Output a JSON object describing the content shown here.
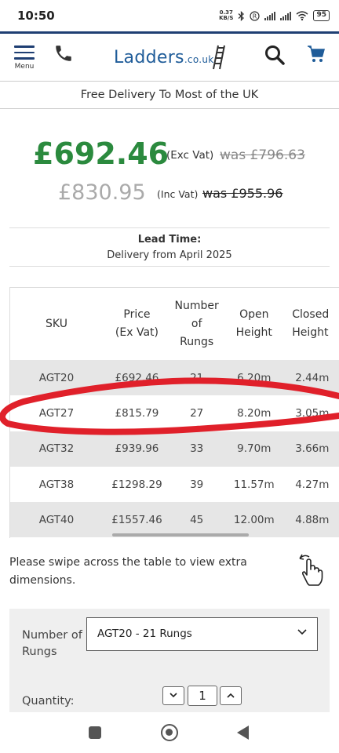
{
  "status_bar": {
    "time": "10:50",
    "net_speed_value": "0.37",
    "net_speed_unit": "KB/S",
    "battery": "95"
  },
  "header": {
    "menu_label": "Menu",
    "logo_main": "Ladders",
    "logo_suffix": ".co.uk"
  },
  "delivery_banner": "Free Delivery To Most of the UK",
  "pricing": {
    "price_ex_vat": "£692.46",
    "ex_vat_label": "(Exc Vat)",
    "was_ex_vat": "was £796.63",
    "price_inc_vat": "£830.95",
    "inc_vat_label": "(Inc Vat)",
    "was_inc_vat": "was £955.96",
    "price_color": "#2b8a3e"
  },
  "lead_time": {
    "title": "Lead Time:",
    "value": "Delivery from April 2025"
  },
  "table": {
    "headers": [
      "SKU",
      "Price (Ex Vat)",
      "Number of Rungs",
      "Open Height",
      "Closed Height"
    ],
    "header_lines": [
      [
        "SKU"
      ],
      [
        "Price",
        "(Ex Vat)"
      ],
      [
        "Number",
        "of",
        "Rungs"
      ],
      [
        "Open",
        "Height"
      ],
      [
        "Closed",
        "Height"
      ]
    ],
    "rows": [
      {
        "sku": "AGT20",
        "price": "£692.46",
        "rungs": "21",
        "open": "6.20m",
        "closed": "2.44m"
      },
      {
        "sku": "AGT27",
        "price": "£815.79",
        "rungs": "27",
        "open": "8.20m",
        "closed": "3.05m"
      },
      {
        "sku": "AGT32",
        "price": "£939.96",
        "rungs": "33",
        "open": "9.70m",
        "closed": "3.66m"
      },
      {
        "sku": "AGT38",
        "price": "£1298.29",
        "rungs": "39",
        "open": "11.57m",
        "closed": "4.27m"
      },
      {
        "sku": "AGT40",
        "price": "£1557.46",
        "rungs": "45",
        "open": "12.00m",
        "closed": "4.88m"
      }
    ],
    "highlighted_sku": "AGT27",
    "highlight_color": "#e0202a"
  },
  "swipe_hint": "Please swipe across the table to view extra dimensions.",
  "options": {
    "variant_label": "Number of Rungs",
    "variant_label_lines": [
      "Number of",
      "Rungs"
    ],
    "variant_selected": "AGT20 - 21 Rungs",
    "quantity_label": "Quantity:",
    "quantity_value": "1"
  },
  "icons": {
    "menu": "hamburger-icon",
    "phone": "phone-icon",
    "search": "search-icon",
    "cart": "cart-icon",
    "swipe": "hand-swipe-icon"
  },
  "brand_color": "#1f3f73"
}
